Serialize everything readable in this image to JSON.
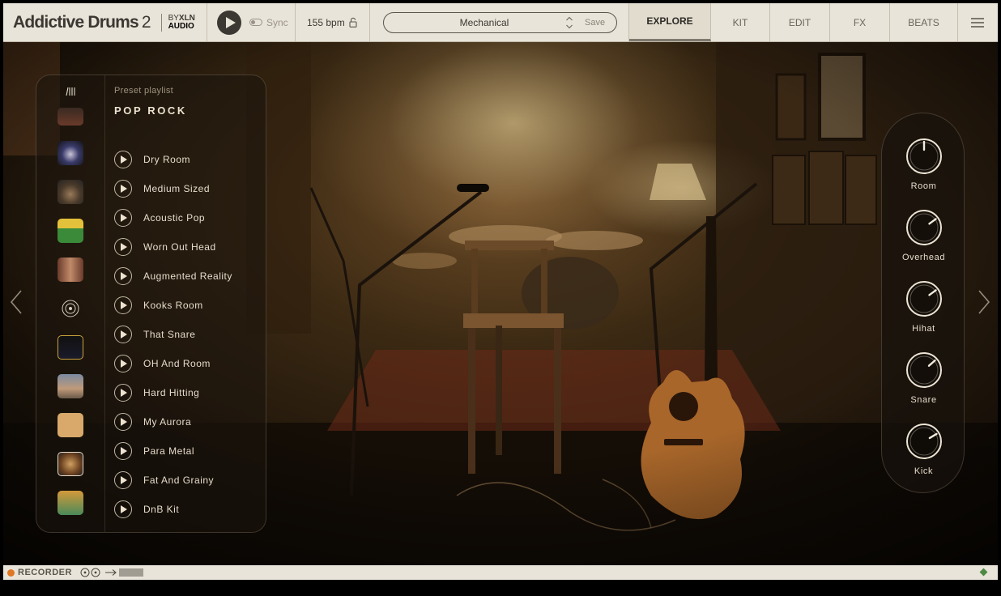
{
  "header": {
    "logo_main": "Addictive Drums",
    "logo_version": "2",
    "logo_by": "BY",
    "logo_brand": "XLN",
    "logo_brand2": "AUDIO",
    "sync_label": "Sync",
    "tempo": "155 bpm",
    "preset_name": "Mechanical",
    "save_label": "Save",
    "tabs": [
      "EXPLORE",
      "KIT",
      "EDIT",
      "FX",
      "BEATS"
    ],
    "active_tab": "EXPLORE"
  },
  "playlist": {
    "subtitle": "Preset playlist",
    "title": "POP ROCK",
    "items": [
      "Dry Room",
      "Medium Sized",
      "Acoustic Pop",
      "Worn Out Head",
      "Augmented Reality",
      "Kooks Room",
      "That Snare",
      "OH And Room",
      "Hard Hitting",
      "My Aurora",
      "Para Metal",
      "Fat And Grainy",
      "DnB Kit"
    ]
  },
  "mixer": {
    "knobs": [
      {
        "label": "Room",
        "level": 0.5
      },
      {
        "label": "Overhead",
        "level": 0.7
      },
      {
        "label": "Hihat",
        "level": 0.7
      },
      {
        "label": "Snare",
        "level": 0.68
      },
      {
        "label": "Kick",
        "level": 0.72
      }
    ]
  },
  "recorder": {
    "label": "RECORDER"
  },
  "colors": {
    "header_bg": "#e9e4d9",
    "text_dark": "#3b3833",
    "recorder_dot": "#e07722",
    "status_diamond": "#4e8a44"
  }
}
